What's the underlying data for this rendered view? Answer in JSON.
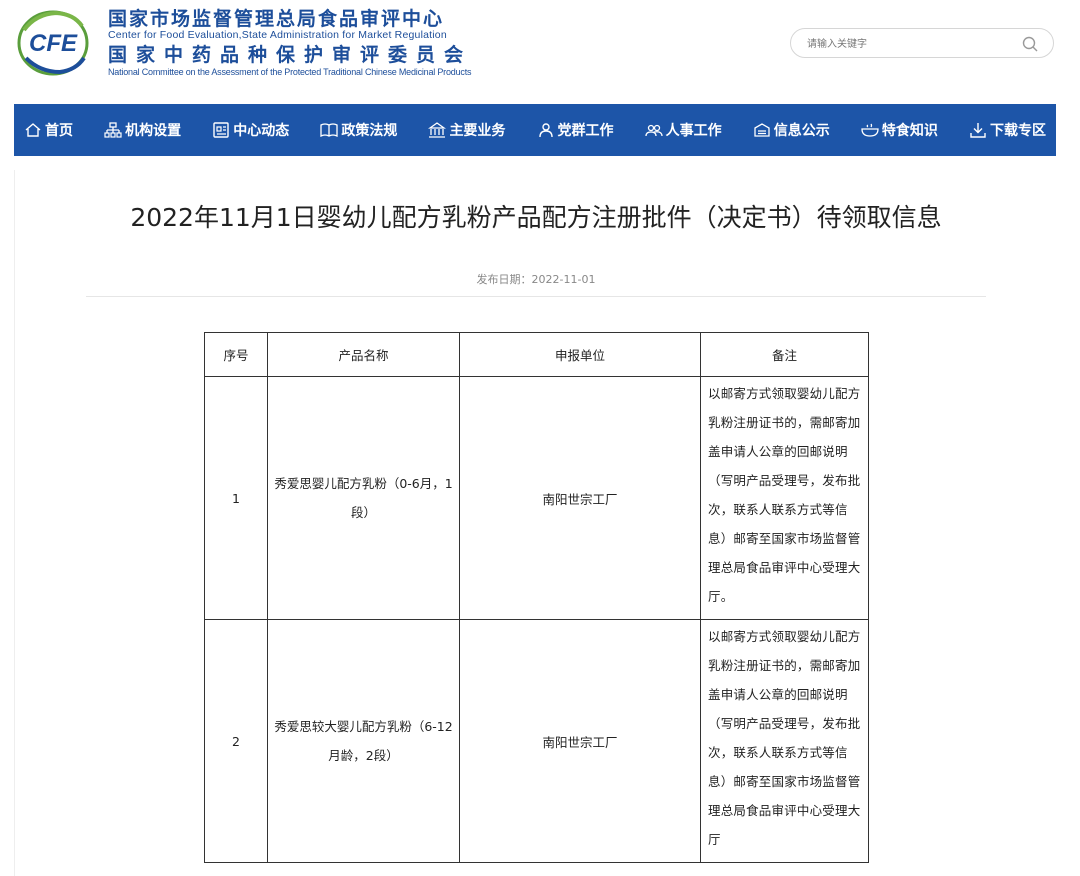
{
  "header": {
    "logo_text": "CFE",
    "org_cn_1": "国家市场监督管理总局食品审评中心",
    "org_en_1": "Center for Food Evaluation,State Administration for Market Regulation",
    "org_cn_2": "国家中药品种保护审评委员会",
    "org_en_2": "National Committee on the Assessment of the Protected Traditional Chinese Medicinal Products",
    "brand_color": "#1d4e9a"
  },
  "search": {
    "placeholder": "请输入关键字",
    "value": ""
  },
  "nav": {
    "bg_color": "#1d55a8",
    "items": [
      {
        "label": "首页",
        "icon": "home-icon"
      },
      {
        "label": "机构设置",
        "icon": "org-chart-icon"
      },
      {
        "label": "中心动态",
        "icon": "news-icon"
      },
      {
        "label": "政策法规",
        "icon": "book-icon"
      },
      {
        "label": "主要业务",
        "icon": "building-icon"
      },
      {
        "label": "党群工作",
        "icon": "person-icon"
      },
      {
        "label": "人事工作",
        "icon": "people-icon"
      },
      {
        "label": "信息公示",
        "icon": "notice-icon"
      },
      {
        "label": "特食知识",
        "icon": "bowl-icon"
      },
      {
        "label": "下载专区",
        "icon": "download-icon"
      }
    ]
  },
  "article": {
    "title": "2022年11月1日婴幼儿配方乳粉产品配方注册批件（决定书）待领取信息",
    "publish_date": "发布日期：2022-11-01"
  },
  "table": {
    "headers": [
      "序号",
      "产品名称",
      "申报单位",
      "备注"
    ],
    "rows": [
      {
        "no": "1",
        "product": "秀爱思婴儿配方乳粉（0-6月，1段）",
        "applicant": "南阳世宗工厂",
        "note": "以邮寄方式领取婴幼儿配方乳粉注册证书的，需邮寄加盖申请人公章的回邮说明（写明产品受理号，发布批次，联系人联系方式等信息）邮寄至国家市场监督管理总局食品审评中心受理大厅。"
      },
      {
        "no": "2",
        "product": "秀爱思较大婴儿配方乳粉（6-12月龄，2段）",
        "applicant": "南阳世宗工厂",
        "note": "以邮寄方式领取婴幼儿配方乳粉注册证书的，需邮寄加盖申请人公章的回邮说明（写明产品受理号，发布批次，联系人联系方式等信息）邮寄至国家市场监督管理总局食品审评中心受理大厅"
      }
    ]
  }
}
